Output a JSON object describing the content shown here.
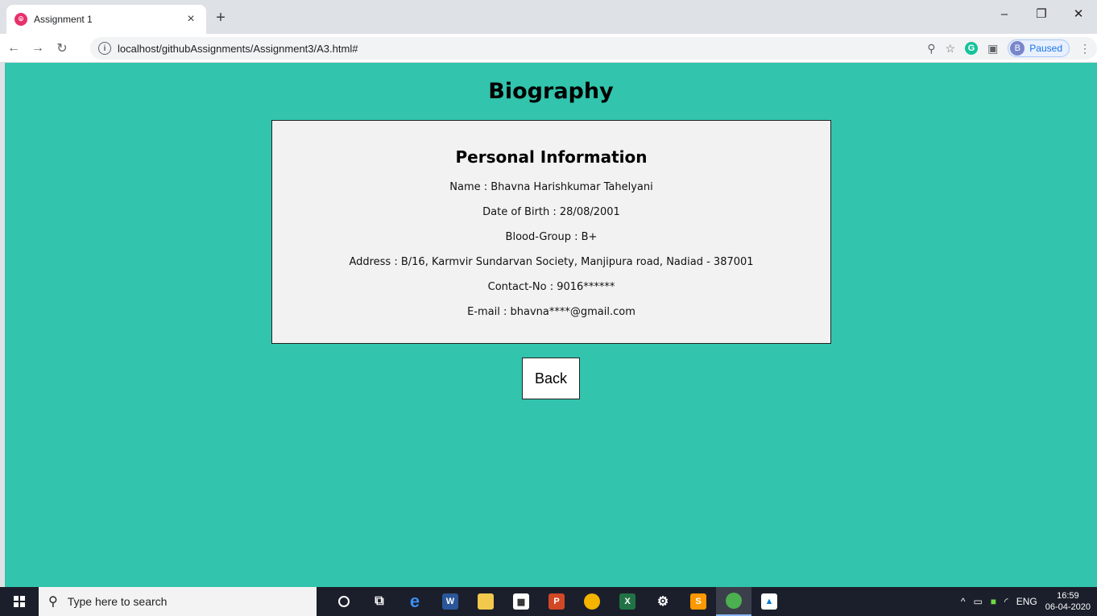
{
  "browser": {
    "tab_title": "Assignment 1",
    "tab_close": "×",
    "new_tab": "+",
    "url": "localhost/githubAssignments/Assignment3/A3.html#",
    "profile_initial": "B",
    "profile_status": "Paused",
    "window_minimize": "–",
    "window_restore": "❐",
    "window_close": "✕"
  },
  "page": {
    "title": "Biography",
    "card_heading": "Personal Information",
    "lines": [
      "Name : Bhavna Harishkumar Tahelyani",
      "Date of Birth : 28/08/2001",
      "Blood-Group : B+",
      "Address : B/16, Karmvir Sundarvan Society, Manjipura road, Nadiad - 387001",
      "Contact-No : 9016******",
      "E-mail : bhavna****@gmail.com"
    ],
    "back_label": "Back",
    "background_color": "#32c4ad"
  },
  "taskbar": {
    "search_placeholder": "Type here to search",
    "language": "ENG",
    "time": "16:59",
    "date": "06-04-2020"
  }
}
